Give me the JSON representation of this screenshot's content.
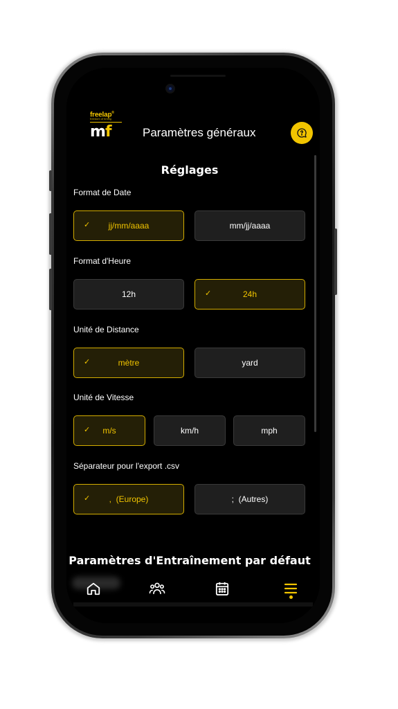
{
  "header": {
    "logo_brand": "freelap",
    "logo_tagline": "freedom of timing",
    "logo_app": "mf",
    "title": "Paramètres généraux",
    "help_icon": "chat-question-icon"
  },
  "settings": {
    "section_title": "Réglages",
    "date_format": {
      "label": "Format de Date",
      "options": [
        "jj/mm/aaaa",
        "mm/jj/aaaa"
      ],
      "selected": "jj/mm/aaaa"
    },
    "time_format": {
      "label": "Format d'Heure",
      "options": [
        "12h",
        "24h"
      ],
      "selected": "24h"
    },
    "distance_unit": {
      "label": "Unité de Distance",
      "options": [
        "mètre",
        "yard"
      ],
      "selected": "mètre"
    },
    "speed_unit": {
      "label": "Unité de Vitesse",
      "options": [
        "m/s",
        "km/h",
        "mph"
      ],
      "selected": "m/s"
    },
    "csv_separator": {
      "label": "Séparateur pour l'export .csv",
      "options": [
        ",  (Europe)",
        ";  (Autres)"
      ],
      "selected": ",  (Europe)"
    },
    "check_glyph": "✓"
  },
  "training": {
    "section_title": "Paramètres d'Entraînement par défaut"
  },
  "bottom_nav": {
    "items": [
      "home-icon",
      "users-icon",
      "calendar-icon",
      "menu-icon"
    ],
    "active": "menu-icon"
  },
  "colors": {
    "accent": "#f2c500",
    "background": "#000000",
    "option_bg": "#1f1f1f"
  }
}
